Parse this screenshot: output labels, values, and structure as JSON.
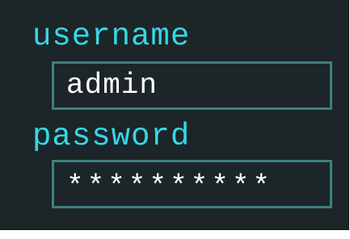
{
  "login_form": {
    "username": {
      "label": "username",
      "value": "admin"
    },
    "password": {
      "label": "password",
      "value": "**********"
    },
    "colors": {
      "background": "#1c2527",
      "label": "#35d7e8",
      "field_border": "#3d7f80",
      "field_text": "#ffffff"
    }
  }
}
